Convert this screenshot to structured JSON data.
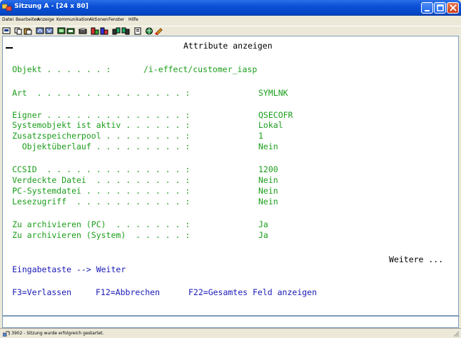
{
  "window": {
    "title": "Sitzung A - [24 x 80]"
  },
  "menu": [
    "Datei",
    "Bearbeiten",
    "Anzeige",
    "Kommunikation",
    "Aktionen",
    "Fenster",
    "Hilfe"
  ],
  "screen": {
    "heading": "Attribute anzeigen",
    "objekt_label": "Objekt . . . . . . :",
    "objekt_value": "/i-effect/customer_iasp",
    "fields": [
      {
        "label": "Art  . . . . . . . . . . . . . . . :",
        "value": "SYMLNK"
      },
      {
        "label": "Eigner . . . . . . . . . . . . . . :",
        "value": "QSECOFR"
      },
      {
        "label": "Systemobjekt ist aktiv . . . . . . :",
        "value": "Lokal"
      },
      {
        "label": "Zusatzspeicherpool . . . . . . . . :",
        "value": "1"
      },
      {
        "label": "  Objektüberlauf . . . . . . . . . :",
        "value": "Nein"
      },
      {
        "label": "CCSID  . . . . . . . . . . . . . . :",
        "value": "1200"
      },
      {
        "label": "Verdeckte Datei  . . . . . . . . . :",
        "value": "Nein"
      },
      {
        "label": "PC-Systemdatei . . . . . . . . . . :",
        "value": "Nein"
      },
      {
        "label": "Lesezugriff  . . . . . . . . . . . :",
        "value": "Nein"
      },
      {
        "label": "Zu archivieren (PC)  . . . . . . . :",
        "value": "Ja"
      },
      {
        "label": "Zu archivieren (System)  . . . . . :",
        "value": "Ja"
      }
    ],
    "more": "Weitere ...",
    "enter_hint": "Eingabetaste --> Weiter",
    "fkeys": {
      "f3": "F3=Verlassen",
      "f12": "F12=Abbrechen",
      "f22": "F22=Gesamtes Feld anzeigen"
    }
  },
  "status": {
    "text": "3902 - Sitzung wurde erfolgreich gestartet."
  },
  "colors": {
    "terminal_green": "#1b9e1b",
    "terminal_blue": "#1a1ab8",
    "titlebar_blue": "#0a4fd6"
  }
}
